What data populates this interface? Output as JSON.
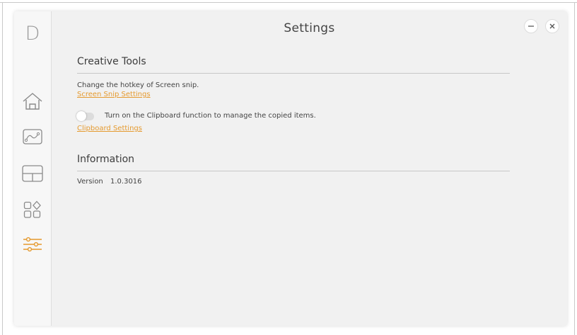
{
  "window": {
    "title": "Settings"
  },
  "sidebar": {
    "logo": "D",
    "items": [
      {
        "name": "home",
        "icon": "home-icon",
        "active": false
      },
      {
        "name": "drawing",
        "icon": "drawing-icon",
        "active": false
      },
      {
        "name": "layout",
        "icon": "layout-icon",
        "active": false
      },
      {
        "name": "apps",
        "icon": "apps-icon",
        "active": false
      },
      {
        "name": "settings",
        "icon": "settings-sliders-icon",
        "active": true
      }
    ]
  },
  "creative_tools": {
    "title": "Creative Tools",
    "screen_snip_desc": "Change the hotkey of Screen snip.",
    "screen_snip_link": "Screen Snip Settings",
    "clipboard_toggle_label": "Turn on the Clipboard function to manage the copied items.",
    "clipboard_toggle_on": false,
    "clipboard_link": "Clipboard Settings"
  },
  "information": {
    "title": "Information",
    "version_label": "Version",
    "version_value": "1.0.3016"
  },
  "colors": {
    "accent": "#e59a2f",
    "icon_inactive": "#8a8a8a",
    "background": "#f1f1f1"
  }
}
